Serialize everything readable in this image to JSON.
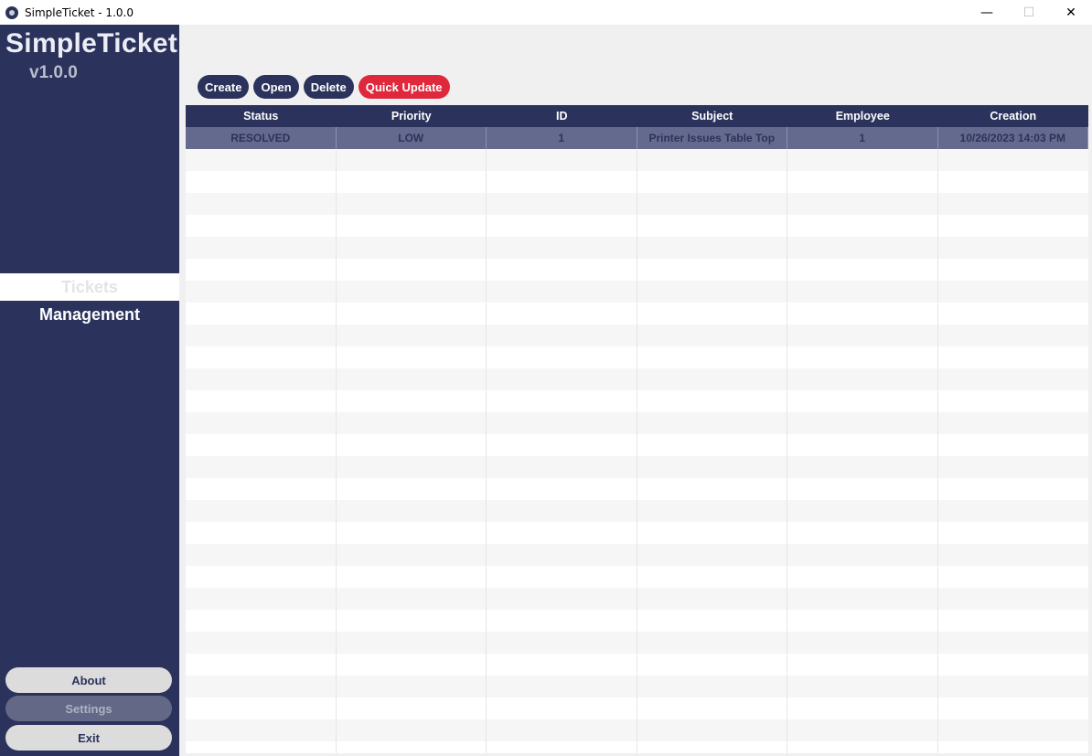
{
  "window": {
    "title": "SimpleTicket - 1.0.0",
    "controls": {
      "minimize": "—",
      "maximize": "☐",
      "close": "✕"
    }
  },
  "sidebar": {
    "brand": "SimpleTicket",
    "version": "v1.0.0",
    "nav": {
      "tickets": "Tickets",
      "management": "Management"
    },
    "buttons": {
      "about": "About",
      "settings": "Settings",
      "exit": "Exit"
    }
  },
  "toolbar": {
    "create": "Create",
    "open": "Open",
    "delete": "Delete",
    "quick_update": "Quick Update"
  },
  "table": {
    "columns": [
      "Status",
      "Priority",
      "ID",
      "Subject",
      "Employee",
      "Creation"
    ],
    "rows": [
      [
        "RESOLVED",
        "LOW",
        "1",
        "Printer Issues Table Top",
        "1",
        "10/26/2023 14:03 PM"
      ]
    ]
  },
  "colors": {
    "sidebar": "#2b335c",
    "accent_red": "#e0283d",
    "selected_row": "#636a8e"
  }
}
